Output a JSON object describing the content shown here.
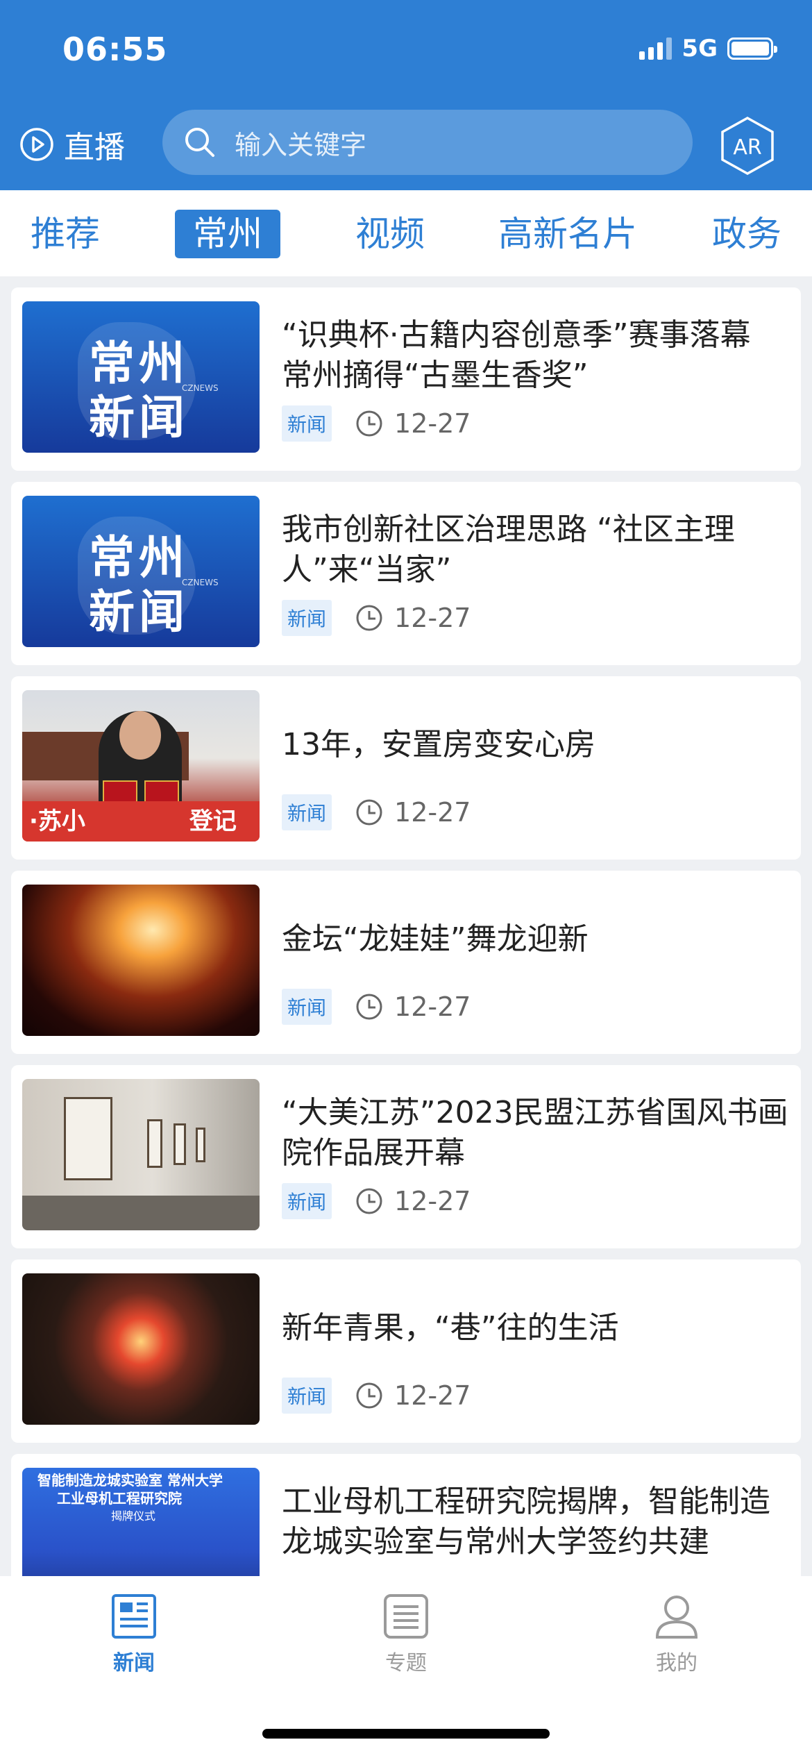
{
  "status": {
    "time": "06:55",
    "network": "5G"
  },
  "header": {
    "live_label": "直播",
    "search_placeholder": "输入关键字",
    "ar_label": "AR"
  },
  "tabs": [
    {
      "label": "推荐",
      "active": false
    },
    {
      "label": "常州",
      "active": true
    },
    {
      "label": "视频",
      "active": false
    },
    {
      "label": "高新名片",
      "active": false
    },
    {
      "label": "政务",
      "active": false
    }
  ],
  "thumb_text": {
    "brand_line1": "常州",
    "brand_line2": "新闻",
    "brand_en": "CZNEWS",
    "banner_fragment": "·苏小",
    "banner_fragment2": "登记志",
    "stage_line1": "智能制造龙城实验室  常州大学",
    "stage_line2": "工业母机工程研究院",
    "stage_line3": "揭牌仪式"
  },
  "news": [
    {
      "title": "“识典杯·古籍内容创意季”赛事落幕 常州摘得“古墨生香奖”",
      "tag": "新闻",
      "date": "12-27",
      "thumb": "brand"
    },
    {
      "title": "我市创新社区治理思路 “社区主理人”来“当家”",
      "tag": "新闻",
      "date": "12-27",
      "thumb": "brand"
    },
    {
      "title": "13年，安置房变安心房",
      "tag": "新闻",
      "date": "12-27",
      "thumb": "woman"
    },
    {
      "title": "金坛“龙娃娃”舞龙迎新",
      "tag": "新闻",
      "date": "12-27",
      "thumb": "fire"
    },
    {
      "title": "“大美江苏”2023民盟江苏省国风书画院作品展开幕",
      "tag": "新闻",
      "date": "12-27",
      "thumb": "gallery"
    },
    {
      "title": "新年青果，“巷”往的生活",
      "tag": "新闻",
      "date": "12-27",
      "thumb": "lantern"
    },
    {
      "title": "工业母机工程研究院揭牌，智能制造龙城实验室与常州大学签约共建",
      "tag": "",
      "date": "",
      "thumb": "stage"
    }
  ],
  "bottom_nav": [
    {
      "label": "新闻",
      "icon": "newspaper-icon",
      "active": true
    },
    {
      "label": "专题",
      "icon": "list-icon",
      "active": false
    },
    {
      "label": "我的",
      "icon": "person-icon",
      "active": false
    }
  ],
  "colors": {
    "brand": "#2e7fd4",
    "inactive": "#9a9a9a"
  }
}
